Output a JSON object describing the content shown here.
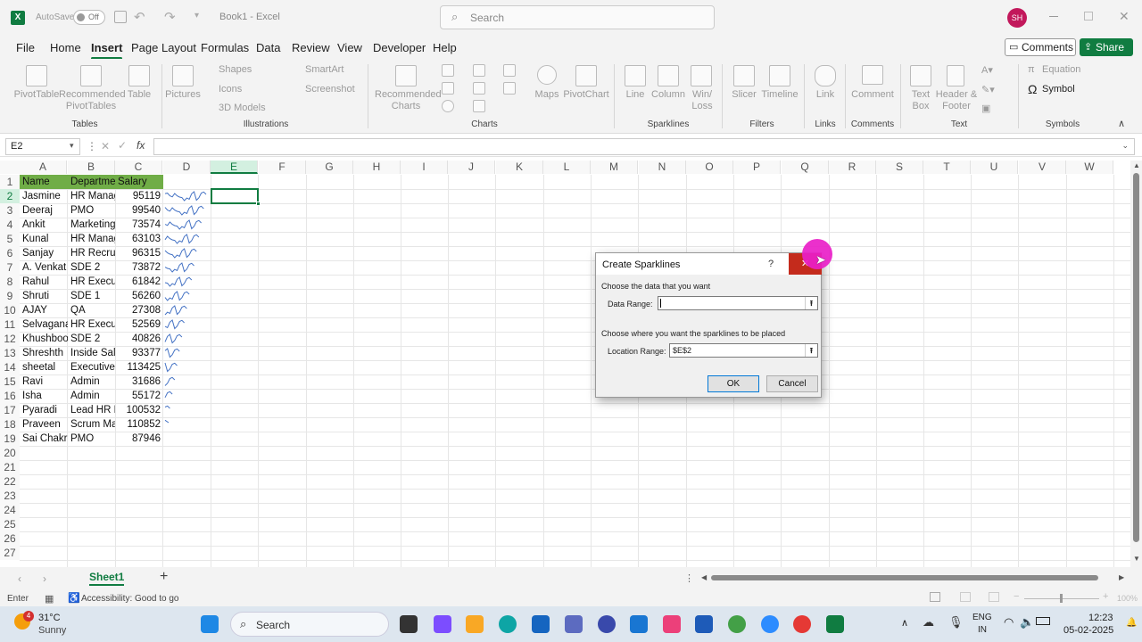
{
  "titlebar": {
    "autosave_label": "AutoSave",
    "autosave_state": "Off",
    "doc_title": "Book1 - Excel",
    "search_placeholder": "Search",
    "avatar_initials": "SH"
  },
  "menu": {
    "items": [
      "File",
      "Home",
      "Insert",
      "Page Layout",
      "Formulas",
      "Data",
      "Review",
      "View",
      "Developer",
      "Help"
    ],
    "comments_label": "Comments",
    "share_label": "Share"
  },
  "ribbon": {
    "pivottable": "PivotTable",
    "recommended_pivot": "Recommended PivotTables",
    "table": "Table",
    "tables_group": "Tables",
    "pictures": "Pictures",
    "shapes": "Shapes",
    "icons": "Icons",
    "models3d": "3D Models",
    "smartart": "SmartArt",
    "screenshot": "Screenshot",
    "illustrations_group": "Illustrations",
    "recommended_charts": "Recommended Charts",
    "maps": "Maps",
    "pivotchart": "PivotChart",
    "charts_group": "Charts",
    "line": "Line",
    "column": "Column",
    "winloss": "Win/ Loss",
    "sparklines_group": "Sparklines",
    "slicer": "Slicer",
    "timeline": "Timeline",
    "filters_group": "Filters",
    "link": "Link",
    "links_group": "Links",
    "comment": "Comment",
    "comments_group": "Comments",
    "textbox": "Text Box",
    "headerfooter": "Header & Footer",
    "text_group": "Text",
    "equation": "Equation",
    "symbol": "Symbol",
    "symbols_group": "Symbols"
  },
  "formula_bar": {
    "name_box": "E2",
    "fx": "fx",
    "content": ""
  },
  "columns": [
    "A",
    "B",
    "C",
    "D",
    "E",
    "F",
    "G",
    "H",
    "I",
    "J",
    "K",
    "L",
    "M",
    "N",
    "O",
    "P",
    "Q",
    "R",
    "S",
    "T",
    "U",
    "V",
    "W"
  ],
  "rows": [
    "1",
    "2",
    "3",
    "4",
    "5",
    "6",
    "7",
    "8",
    "9",
    "10",
    "11",
    "12",
    "13",
    "14",
    "15",
    "16",
    "17",
    "18",
    "19",
    "20",
    "21",
    "22",
    "23",
    "24",
    "25",
    "26",
    "27"
  ],
  "sheet": {
    "headers": [
      "Name",
      "Departme",
      "Salary"
    ],
    "data": [
      [
        "Jasmine",
        "HR Manag",
        "95119"
      ],
      [
        "Deeraj",
        "PMO",
        "99540"
      ],
      [
        "Ankit",
        "Marketing",
        "73574"
      ],
      [
        "Kunal",
        "HR Manag",
        "63103"
      ],
      [
        "Sanjay",
        "HR Recruit",
        "96315"
      ],
      [
        "A. Venkat",
        "SDE 2",
        "73872"
      ],
      [
        "Rahul",
        "HR Executi",
        "61842"
      ],
      [
        "Shruti",
        "SDE 1",
        "56260"
      ],
      [
        "AJAY",
        "QA",
        "27308"
      ],
      [
        "Selvaganaj",
        "HR Executi",
        "52569"
      ],
      [
        "Khushboo",
        "SDE 2",
        "40826"
      ],
      [
        "Shreshth",
        "Inside Sale",
        "93377"
      ],
      [
        "sheetal",
        "Executive I",
        "113425"
      ],
      [
        "Ravi",
        "Admin",
        "31686"
      ],
      [
        "Isha",
        "Admin",
        "55172"
      ],
      [
        "Pyaradi",
        "Lead HR M",
        "100532"
      ],
      [
        "Praveen",
        "Scrum Mas",
        "110852"
      ],
      [
        "Sai Chakri",
        "PMO",
        "87946"
      ]
    ],
    "header_color": "#70ad47"
  },
  "dialog": {
    "title": "Create Sparklines",
    "help": "?",
    "section1": "Choose the data that you want",
    "data_range_label": "Data Range:",
    "data_range_value": "",
    "section2": "Choose where you want the sparklines to be placed",
    "location_label": "Location Range:",
    "location_value": "$E$2",
    "ok": "OK",
    "cancel": "Cancel"
  },
  "sheet_tabs": {
    "active": "Sheet1",
    "add": "+"
  },
  "status": {
    "mode": "Enter",
    "accessibility": "Accessibility: Good to go",
    "zoom": "100%"
  },
  "taskbar": {
    "weather_temp": "31°C",
    "weather_desc": "Sunny",
    "weather_badge": "4",
    "search": "Search",
    "lang1": "ENG",
    "lang2": "IN",
    "time": "12:23",
    "date": "05-02-2025"
  },
  "colors": {
    "excel_green": "#107c41",
    "close_red": "#c42b1c",
    "pink_cursor": "#e91ec8"
  }
}
